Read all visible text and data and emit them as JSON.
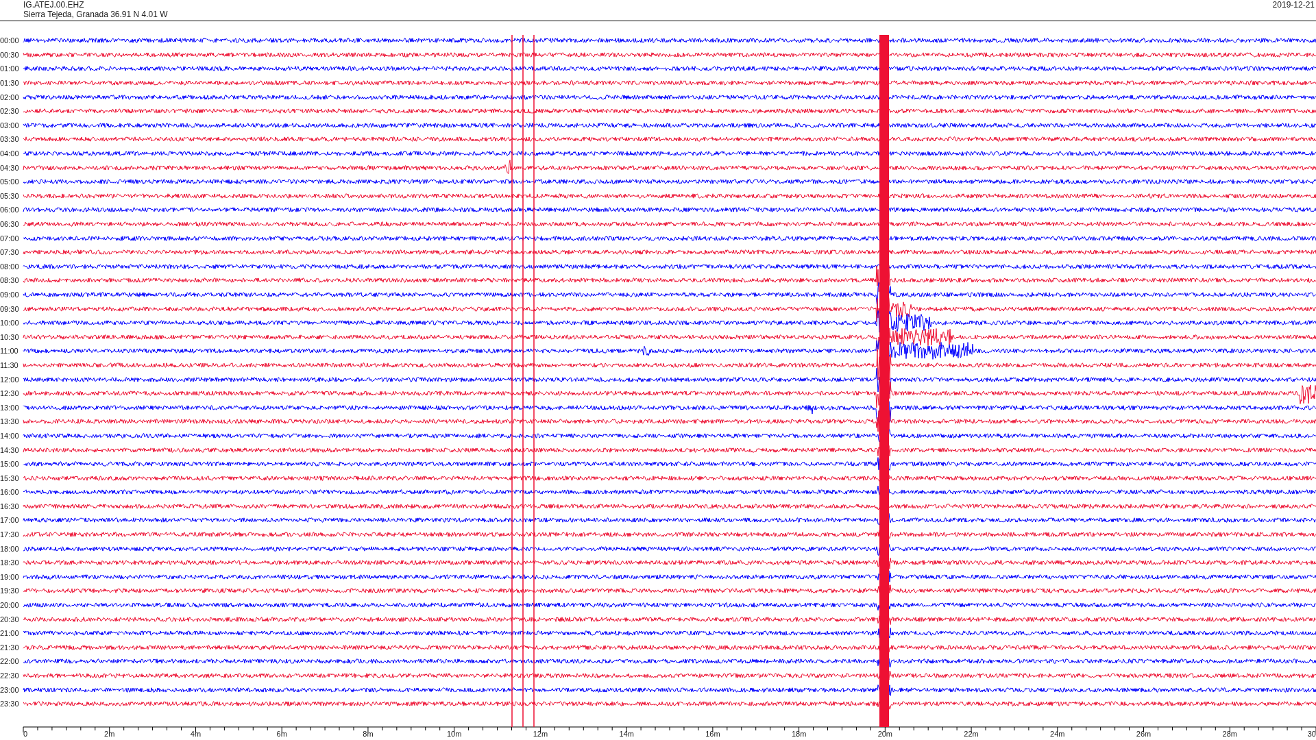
{
  "header": {
    "channel": "IG.ATEJ.00.EHZ",
    "location": "Sierra Tejeda, Granada  36.91 N 4.01 W",
    "date": "2019-12-21"
  },
  "rows": [
    {
      "time": "00:00",
      "color": "#0000ff"
    },
    {
      "time": "00:30",
      "color": "#ee1133"
    },
    {
      "time": "01:00",
      "color": "#0000ff"
    },
    {
      "time": "01:30",
      "color": "#ee1133"
    },
    {
      "time": "02:00",
      "color": "#0000ff"
    },
    {
      "time": "02:30",
      "color": "#ee1133"
    },
    {
      "time": "03:00",
      "color": "#0000ff"
    },
    {
      "time": "03:30",
      "color": "#ee1133"
    },
    {
      "time": "04:00",
      "color": "#0000ff"
    },
    {
      "time": "04:30",
      "color": "#ee1133"
    },
    {
      "time": "05:00",
      "color": "#0000ff"
    },
    {
      "time": "05:30",
      "color": "#ee1133"
    },
    {
      "time": "06:00",
      "color": "#0000ff"
    },
    {
      "time": "06:30",
      "color": "#ee1133"
    },
    {
      "time": "07:00",
      "color": "#0000ff"
    },
    {
      "time": "07:30",
      "color": "#ee1133"
    },
    {
      "time": "08:00",
      "color": "#0000ff"
    },
    {
      "time": "08:30",
      "color": "#ee1133"
    },
    {
      "time": "09:00",
      "color": "#0000ff"
    },
    {
      "time": "09:30",
      "color": "#ee1133"
    },
    {
      "time": "10:00",
      "color": "#0000ff"
    },
    {
      "time": "10:30",
      "color": "#ee1133"
    },
    {
      "time": "11:00",
      "color": "#0000ff"
    },
    {
      "time": "11:30",
      "color": "#ee1133"
    },
    {
      "time": "12:00",
      "color": "#0000ff"
    },
    {
      "time": "12:30",
      "color": "#ee1133"
    },
    {
      "time": "13:00",
      "color": "#0000ff"
    },
    {
      "time": "13:30",
      "color": "#ee1133"
    },
    {
      "time": "14:00",
      "color": "#0000ff"
    },
    {
      "time": "14:30",
      "color": "#ee1133"
    },
    {
      "time": "15:00",
      "color": "#0000ff"
    },
    {
      "time": "15:30",
      "color": "#ee1133"
    },
    {
      "time": "16:00",
      "color": "#0000ff"
    },
    {
      "time": "16:30",
      "color": "#ee1133"
    },
    {
      "time": "17:00",
      "color": "#0000ff"
    },
    {
      "time": "17:30",
      "color": "#ee1133"
    },
    {
      "time": "18:00",
      "color": "#0000ff"
    },
    {
      "time": "18:30",
      "color": "#ee1133"
    },
    {
      "time": "19:00",
      "color": "#0000ff"
    },
    {
      "time": "19:30",
      "color": "#ee1133"
    },
    {
      "time": "20:00",
      "color": "#0000ff"
    },
    {
      "time": "20:30",
      "color": "#ee1133"
    },
    {
      "time": "21:00",
      "color": "#0000ff"
    },
    {
      "time": "21:30",
      "color": "#ee1133"
    },
    {
      "time": "22:00",
      "color": "#0000ff"
    },
    {
      "time": "22:30",
      "color": "#ee1133"
    },
    {
      "time": "23:00",
      "color": "#0000ff"
    },
    {
      "time": "23:30",
      "color": "#ee1133"
    }
  ],
  "axis": {
    "ticks": [
      {
        "label": "0"
      },
      {
        "label": "2m"
      },
      {
        "label": "4m"
      },
      {
        "label": "6m"
      },
      {
        "label": "8m"
      },
      {
        "label": "10m"
      },
      {
        "label": "12m"
      },
      {
        "label": "14m"
      },
      {
        "label": "16m"
      },
      {
        "label": "18m"
      },
      {
        "label": "20m"
      },
      {
        "label": "22m"
      },
      {
        "label": "24m"
      },
      {
        "label": "26m"
      },
      {
        "label": "28m"
      },
      {
        "label": "30"
      }
    ]
  }
}
